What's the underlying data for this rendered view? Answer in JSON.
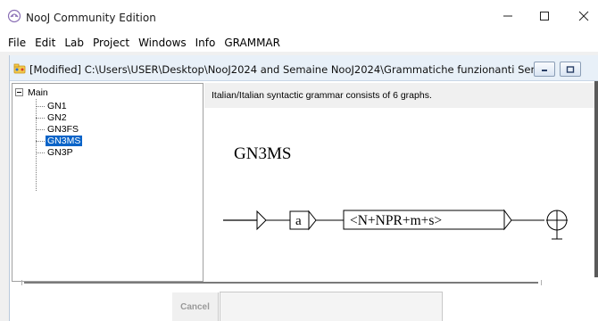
{
  "app": {
    "title": "NooJ Community Edition"
  },
  "window_controls": {
    "minimize": "─",
    "maximize": "☐",
    "close": "✕"
  },
  "menu": [
    "File",
    "Edit",
    "Lab",
    "Project",
    "Windows",
    "Info",
    "GRAMMAR"
  ],
  "document": {
    "title": "[Modified] C:\\Users\\USER\\Desktop\\NooJ2024 and Semaine NooJ2024\\Grammatiche funzionanti Semaine N..."
  },
  "tree": {
    "root": "Main",
    "items": [
      {
        "label": "GN1",
        "selected": false
      },
      {
        "label": "GN2",
        "selected": false
      },
      {
        "label": "GN3FS",
        "selected": false
      },
      {
        "label": "GN3MS",
        "selected": true
      },
      {
        "label": "GN3P",
        "selected": false
      }
    ]
  },
  "info": {
    "text": "Italian/Italian syntactic grammar consists of 6 graphs."
  },
  "graph": {
    "name": "GN3MS",
    "nodes": [
      "a",
      "<N+NPR+m+s>"
    ]
  },
  "buttons": {
    "cancel": "Cancel"
  },
  "colors": {
    "selection": "#0a64c8",
    "child_title_bg": "#e8f0f8",
    "info_bg": "#f0f0f0"
  },
  "icons": {
    "app": "nooj-app-icon",
    "document": "grammar-document-icon"
  }
}
